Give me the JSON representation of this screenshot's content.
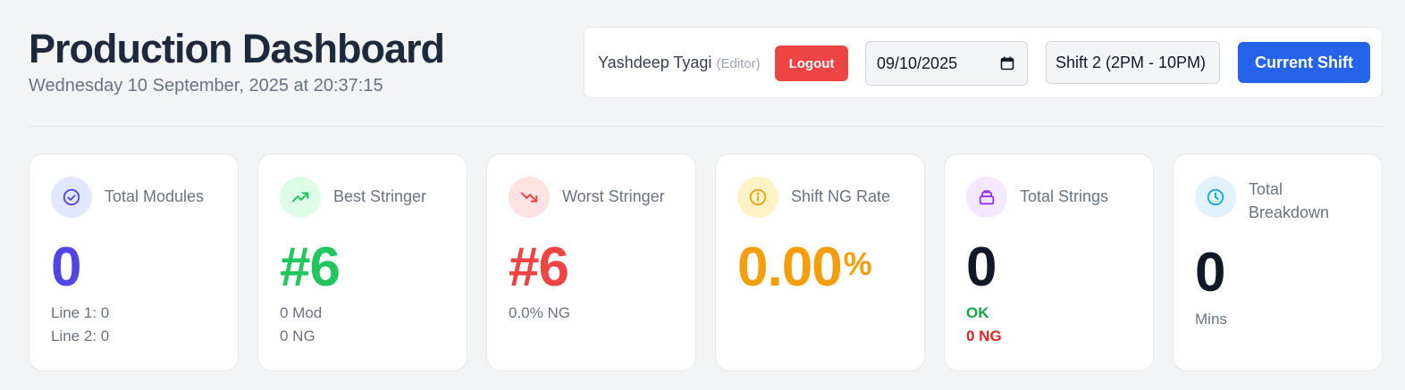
{
  "header": {
    "title": "Production Dashboard",
    "datetime": "Wednesday 10 September, 2025 at 20:37:15"
  },
  "controls": {
    "user_name": "Yashdeep Tyagi",
    "user_role": "(Editor)",
    "logout_label": "Logout",
    "date_value": "09/10/2025",
    "shift_value": "Shift 2 (2PM - 10PM)",
    "current_shift_label": "Current Shift",
    "colors": {
      "logout": "#ef4444",
      "current_shift": "#2563eb"
    }
  },
  "cards": {
    "total_modules": {
      "title": "Total Modules",
      "value": "0",
      "line1": "Line 1: 0",
      "line2": "Line 2: 0",
      "icon": "check-circle-icon",
      "color": "#4f46e5"
    },
    "best_stringer": {
      "title": "Best Stringer",
      "value": "#6",
      "line1": "0 Mod",
      "line2": "0 NG",
      "icon": "trending-up-icon",
      "color": "#22c55e"
    },
    "worst_stringer": {
      "title": "Worst Stringer",
      "value": "#6",
      "line1": "0.0% NG",
      "icon": "trending-down-icon",
      "color": "#ef4444"
    },
    "shift_ng_rate": {
      "title": "Shift NG Rate",
      "value": "0.00",
      "unit": "%",
      "icon": "info-icon",
      "color": "#f59e0b"
    },
    "total_strings": {
      "title": "Total Strings",
      "value": "0",
      "ok_label": "OK",
      "ng_label": "0 NG",
      "icon": "layers-icon",
      "color": "#9333ea"
    },
    "total_breakdown": {
      "title": "Total Breakdown",
      "value": "0",
      "unit": "Mins",
      "icon": "clock-icon",
      "color": "#0ea5e9"
    }
  }
}
